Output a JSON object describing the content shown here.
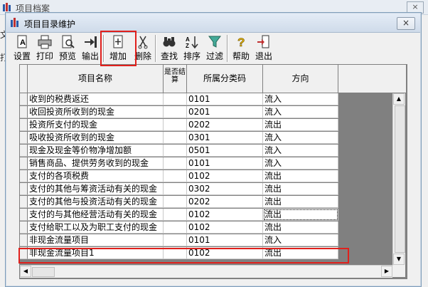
{
  "background_window": {
    "title": "项目档案",
    "close_label": "×",
    "side_left_1": "文",
    "side_left_2": "打"
  },
  "dialog": {
    "title": "项目目录维护",
    "close_label": "×"
  },
  "toolbar": {
    "buttons": [
      {
        "label": "设置",
        "icon": "settings-icon"
      },
      {
        "label": "打印",
        "icon": "print-icon"
      },
      {
        "label": "预览",
        "icon": "preview-icon"
      },
      {
        "label": "输出",
        "icon": "export-icon"
      },
      {
        "label": "增加",
        "icon": "add-icon"
      },
      {
        "label": "删除",
        "icon": "delete-icon"
      },
      {
        "label": "查找",
        "icon": "find-icon"
      },
      {
        "label": "排序",
        "icon": "sort-icon"
      },
      {
        "label": "过滤",
        "icon": "filter-icon"
      },
      {
        "label": "帮助",
        "icon": "help-icon"
      },
      {
        "label": "退出",
        "icon": "exit-icon"
      }
    ]
  },
  "grid": {
    "columns": [
      "项目名称",
      "是否结算",
      "所属分类码",
      "方向"
    ],
    "rows": [
      {
        "name": "收到的税费返还",
        "settle": "",
        "code": "0101",
        "dir": "流入"
      },
      {
        "name": "收回投资所收到的现金",
        "settle": "",
        "code": "0201",
        "dir": "流入"
      },
      {
        "name": "投资所支付的现金",
        "settle": "",
        "code": "0202",
        "dir": "流出"
      },
      {
        "name": "吸收投资所收到的现金",
        "settle": "",
        "code": "0301",
        "dir": "流入"
      },
      {
        "name": "现金及现金等价物净增加额",
        "settle": "",
        "code": "0501",
        "dir": "流入"
      },
      {
        "name": "销售商品、提供劳务收到的现金",
        "settle": "",
        "code": "0101",
        "dir": "流入"
      },
      {
        "name": "支付的各项税费",
        "settle": "",
        "code": "0102",
        "dir": "流出"
      },
      {
        "name": "支付的其他与筹资活动有关的现金",
        "settle": "",
        "code": "0302",
        "dir": "流出"
      },
      {
        "name": "支付的其他与投资活动有关的现金",
        "settle": "",
        "code": "0202",
        "dir": "流出"
      },
      {
        "name": "支付的与其他经营活动有关的现金",
        "settle": "",
        "code": "0102",
        "dir": "流出"
      },
      {
        "name": "支付给职工以及为职工支付的现金",
        "settle": "",
        "code": "0102",
        "dir": "流出"
      },
      {
        "name": "非现金流量项目",
        "settle": "",
        "code": "0101",
        "dir": "流入"
      },
      {
        "name": "非现金流量项目1",
        "settle": "",
        "code": "0102",
        "dir": "流出"
      }
    ]
  },
  "colors": {
    "highlight": "#e0201c",
    "grid_empty": "#808080"
  }
}
